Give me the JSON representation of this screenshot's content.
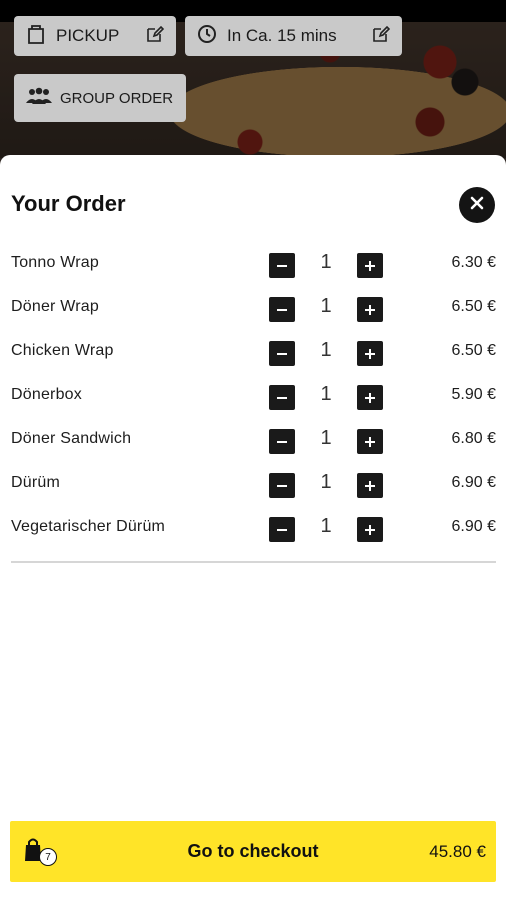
{
  "header": {
    "pickup_label": "PICKUP",
    "time_label": "In Ca. 15 mins",
    "group_order_label": "GROUP ORDER"
  },
  "order": {
    "title": "Your Order",
    "items": [
      {
        "name": "Tonno Wrap",
        "qty": "1",
        "price": "6.30 €"
      },
      {
        "name": "Döner Wrap",
        "qty": "1",
        "price": "6.50 €"
      },
      {
        "name": "Chicken Wrap",
        "qty": "1",
        "price": "6.50 €"
      },
      {
        "name": "Dönerbox",
        "qty": "1",
        "price": "5.90 €"
      },
      {
        "name": "Döner Sandwich",
        "qty": "1",
        "price": "6.80 €"
      },
      {
        "name": "Dürüm",
        "qty": "1",
        "price": "6.90 €"
      },
      {
        "name": "Vegetarischer Dürüm",
        "qty": "1",
        "price": "6.90 €"
      }
    ]
  },
  "checkout": {
    "label": "Go to checkout",
    "total": "45.80 €",
    "item_count": "7"
  },
  "colors": {
    "accent": "#ffe428",
    "button_dark": "#1a1a1a"
  }
}
